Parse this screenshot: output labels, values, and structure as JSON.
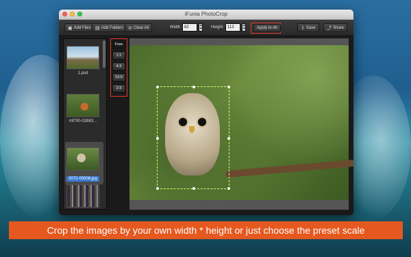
{
  "window": {
    "title": "iFunia PhotoCrop"
  },
  "toolbar": {
    "add_files": "Add Files",
    "add_folders": "Add Folders",
    "clear_all": "Clear All",
    "width_label": "Width",
    "width_value": "82",
    "height_label": "Height",
    "height_value": "113",
    "apply_to_all": "Apply to All",
    "save": "Save",
    "share": "Share"
  },
  "ratios": [
    "Free",
    "1:1",
    "4:3",
    "16:9",
    "2:3"
  ],
  "files": [
    {
      "name": "1.psd"
    },
    {
      "name": "mf700-02883..."
    },
    {
      "name": "3072-00006.jpg",
      "selected": true
    },
    {
      "name": ""
    }
  ],
  "caption": "Crop the images by your own width * height or just choose the preset scale",
  "colors": {
    "accent_red": "#e43b2a",
    "caption_bg": "#e5581f",
    "selection_blue": "#3a78d0",
    "crop_line": "#d6ff6e"
  },
  "icons": [
    "add-files-icon",
    "add-folders-icon",
    "clear-icon",
    "save-icon",
    "share-icon",
    "stepper-up-icon",
    "stepper-down-icon"
  ]
}
